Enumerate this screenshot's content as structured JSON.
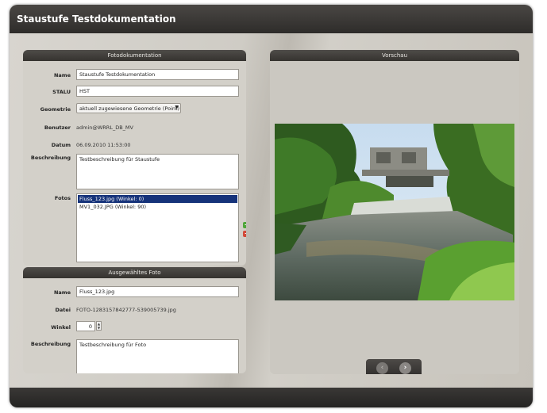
{
  "window": {
    "title": "Staustufe Testdokumentation"
  },
  "foto_panel": {
    "header": "Fotodokumentation",
    "labels": {
      "name": "Name",
      "stalu": "STALU",
      "geometrie": "Geometrie",
      "benutzer": "Benutzer",
      "datum": "Datum",
      "beschreibung": "Beschreibung",
      "fotos": "Fotos"
    },
    "name_value": "Staustufe Testdokumentation",
    "stalu_value": "HST",
    "geometrie_selected": "aktuell zugewiesene Geometrie (Point)",
    "benutzer_value": "admin@WRRL_DB_MV",
    "datum_value": "06.09.2010 11:53:00",
    "beschreibung_value": "Testbeschreibung für Staustufe",
    "fotos": [
      {
        "label": "Fluss_123.jpg (Winkel: 0)",
        "selected": true
      },
      {
        "label": "MV1_032.JPG (Winkel: 90)",
        "selected": false
      }
    ],
    "add_icon": "plus-icon",
    "remove_icon": "minus-icon",
    "colors": {
      "add": "#4fa63a",
      "remove": "#d24a3a",
      "selection": "#16337a"
    }
  },
  "selected_panel": {
    "header": "Ausgewähltes Foto",
    "labels": {
      "name": "Name",
      "datei": "Datei",
      "winkel": "Winkel",
      "beschreibung": "Beschreibung"
    },
    "name_value": "Fluss_123.jpg",
    "datei_value": "FOTO-1283157842777-539005739.jpg",
    "winkel_value": "0",
    "beschreibung_value": "Testbeschreibung für Foto"
  },
  "preview_panel": {
    "header": "Vorschau",
    "prev_icon": "chevron-left-icon",
    "next_icon": "chevron-right-icon"
  }
}
